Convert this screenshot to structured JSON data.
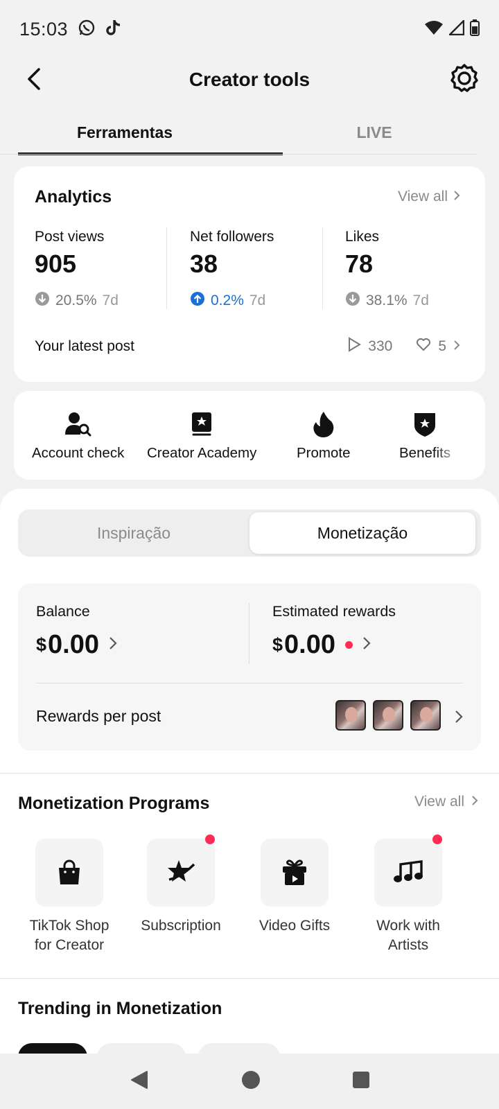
{
  "status": {
    "time": "15:03",
    "icons": [
      "whatsapp-icon",
      "tiktok-icon",
      "wifi-icon",
      "signal-icon",
      "battery-icon"
    ]
  },
  "header": {
    "title": "Creator tools",
    "back_icon": "back-arrow-icon",
    "settings_icon": "gear-icon"
  },
  "tabs": {
    "items": [
      {
        "label": "Ferramentas",
        "active": true
      },
      {
        "label": "LIVE",
        "active": false
      }
    ]
  },
  "analytics": {
    "title": "Analytics",
    "view_all": "View all",
    "metrics": [
      {
        "label": "Post views",
        "value": "905",
        "direction": "down",
        "change": "20.5%",
        "period": "7d"
      },
      {
        "label": "Net followers",
        "value": "38",
        "direction": "up",
        "change": "0.2%",
        "period": "7d"
      },
      {
        "label": "Likes",
        "value": "78",
        "direction": "down",
        "change": "38.1%",
        "period": "7d"
      }
    ],
    "latest_post": {
      "label": "Your latest post",
      "views": "330",
      "likes": "5"
    }
  },
  "tools": [
    {
      "label": "Account check",
      "icon": "account-check-icon"
    },
    {
      "label": "Creator Academy",
      "icon": "academy-book-icon"
    },
    {
      "label": "Promote",
      "icon": "flame-icon"
    },
    {
      "label": "Benefits",
      "icon": "shield-star-icon"
    }
  ],
  "segment": {
    "items": [
      {
        "label": "Inspiração",
        "active": false
      },
      {
        "label": "Monetização",
        "active": true
      }
    ]
  },
  "balance": {
    "balance_label": "Balance",
    "currency": "$",
    "balance_value": "0.00",
    "rewards_label": "Estimated rewards",
    "rewards_value": "0.00",
    "per_post_label": "Rewards per post"
  },
  "programs": {
    "title": "Monetization Programs",
    "view_all": "View all",
    "items": [
      {
        "label": "TikTok Shop for Creator",
        "icon": "shopping-bag-icon",
        "new_dot": false
      },
      {
        "label": "Subscription",
        "icon": "subscription-star-icon",
        "new_dot": true
      },
      {
        "label": "Video Gifts",
        "icon": "gift-icon",
        "new_dot": false
      },
      {
        "label": "Work with Artists",
        "icon": "music-notes-icon",
        "new_dot": true
      }
    ]
  },
  "trending": {
    "title": "Trending in Monetization"
  },
  "colors": {
    "accent_red": "#fe2c55",
    "up_blue": "#1a6fd6",
    "muted_gray": "#8a8a8a"
  }
}
